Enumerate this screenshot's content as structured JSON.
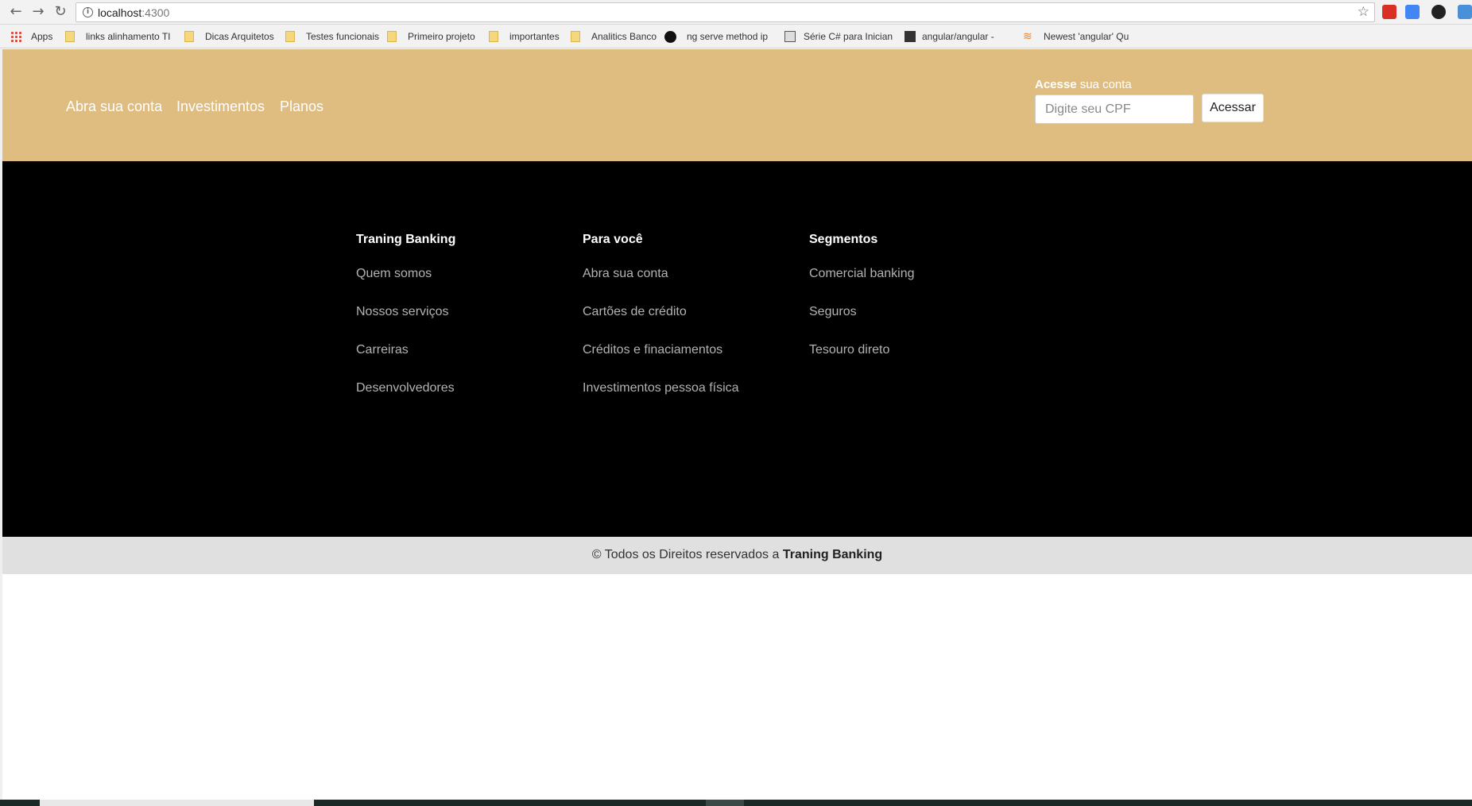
{
  "browser": {
    "url_host": "localhost",
    "url_port": ":4300",
    "bookmarks": [
      {
        "label": "Apps",
        "icon": "apps-icon"
      },
      {
        "label": "links alinhamento TI",
        "icon": "folder-icon"
      },
      {
        "label": "Dicas Arquitetos",
        "icon": "folder-icon"
      },
      {
        "label": "Testes funcionais",
        "icon": "folder-icon"
      },
      {
        "label": "Primeiro projeto",
        "icon": "folder-icon"
      },
      {
        "label": "importantes",
        "icon": "folder-icon"
      },
      {
        "label": "Analitics Banco",
        "icon": "folder-icon"
      },
      {
        "label": "ng serve method ip",
        "icon": "github-icon"
      },
      {
        "label": "Série C# para Inician",
        "icon": "site-icon"
      },
      {
        "label": "angular/angular -",
        "icon": "github-icon"
      },
      {
        "label": "Newest 'angular' Qu",
        "icon": "stackoverflow-icon"
      }
    ]
  },
  "header": {
    "nav": [
      "Abra sua conta",
      "Investimentos",
      "Planos"
    ],
    "login": {
      "label_bold": "Acesse",
      "label_rest": " sua conta",
      "placeholder": "Digite seu CPF",
      "button": "Acessar"
    }
  },
  "footer": {
    "columns": [
      {
        "title": "Traning Banking",
        "links": [
          "Quem somos",
          "Nossos serviços",
          "Carreiras",
          "Desenvolvedores"
        ]
      },
      {
        "title": "Para você",
        "links": [
          "Abra sua conta",
          "Cartões de crédito",
          "Créditos e finaciamentos",
          "Investimentos pessoa física"
        ]
      },
      {
        "title": "Segmentos",
        "links": [
          "Comercial banking",
          "Seguros",
          "Tesouro direto"
        ]
      }
    ],
    "copyright_text": "© Todos os Direitos reservados a ",
    "copyright_brand": "Traning Banking"
  },
  "colors": {
    "header_bg": "#dfbc80",
    "footer_bg": "#000000",
    "copyright_bg": "#e0e0e0"
  }
}
